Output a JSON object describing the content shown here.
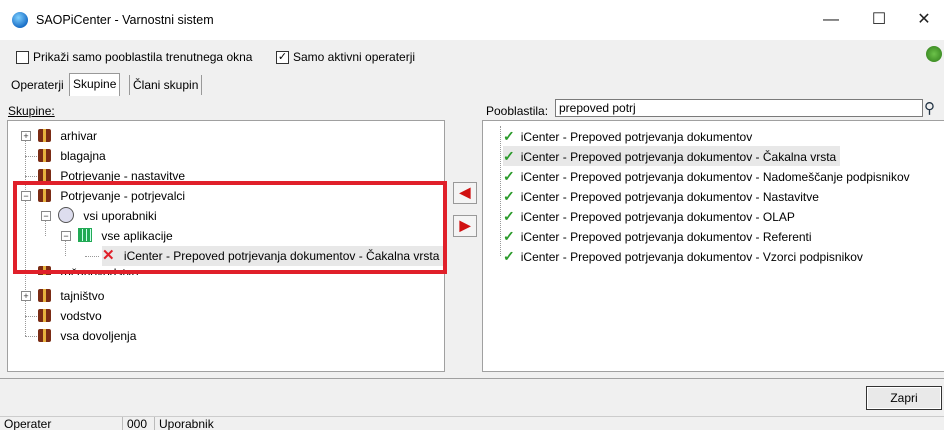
{
  "window": {
    "title": "SAOPiCenter - Varnostni sistem",
    "minimize": "—",
    "maximize": "☐",
    "close": "✕"
  },
  "options": {
    "show_current_window_only": {
      "label": "Prikaži samo pooblastila trenutnega okna",
      "checked": false
    },
    "active_operators_only": {
      "label": "Samo aktivni operaterji",
      "checked": true
    }
  },
  "tabs": [
    {
      "label": "Operaterji",
      "active": false
    },
    {
      "label": "Skupine",
      "active": true
    },
    {
      "label": "Člani skupin",
      "active": false
    }
  ],
  "groups_panel": {
    "label": "Skupine:",
    "items": [
      {
        "label": "arhivar"
      },
      {
        "label": "blagajna"
      },
      {
        "label": "Potrjevanje - nastavitve"
      },
      {
        "label": "Potrjevanje - potrjevalci"
      },
      {
        "label": "vsi uporabniki"
      },
      {
        "label": "vse aplikacije"
      },
      {
        "label": "iCenter - Prepoved potrjevanja dokumentov - Čakalna vrsta"
      },
      {
        "label": "računovodstvo"
      },
      {
        "label": "tajništvo"
      },
      {
        "label": "vodstvo"
      },
      {
        "label": "vsa dovoljenja"
      }
    ]
  },
  "transfer": {
    "add": "◀",
    "remove": "▶"
  },
  "permissions_panel": {
    "label": "Pooblastila:",
    "search_value": "prepoved potrj",
    "items": [
      {
        "label": "iCenter - Prepoved potrjevanja dokumentov"
      },
      {
        "label": "iCenter - Prepoved potrjevanja dokumentov - Čakalna vrsta"
      },
      {
        "label": "iCenter - Prepoved potrjevanja dokumentov - Nadomeščanje podpisnikov"
      },
      {
        "label": "iCenter - Prepoved potrjevanja dokumentov - Nastavitve"
      },
      {
        "label": "iCenter - Prepoved potrjevanja dokumentov - OLAP"
      },
      {
        "label": "iCenter - Prepoved potrjevanja dokumentov - Referenti"
      },
      {
        "label": "iCenter - Prepoved potrjevanja dokumentov - Vzorci podpisnikov"
      }
    ]
  },
  "close_button": "Zapri",
  "status": {
    "operator_label": "Operater",
    "code": "000",
    "user": "Uporabnik"
  },
  "colors": {
    "highlight": "#e0202a",
    "check": "#2a9a2a"
  }
}
